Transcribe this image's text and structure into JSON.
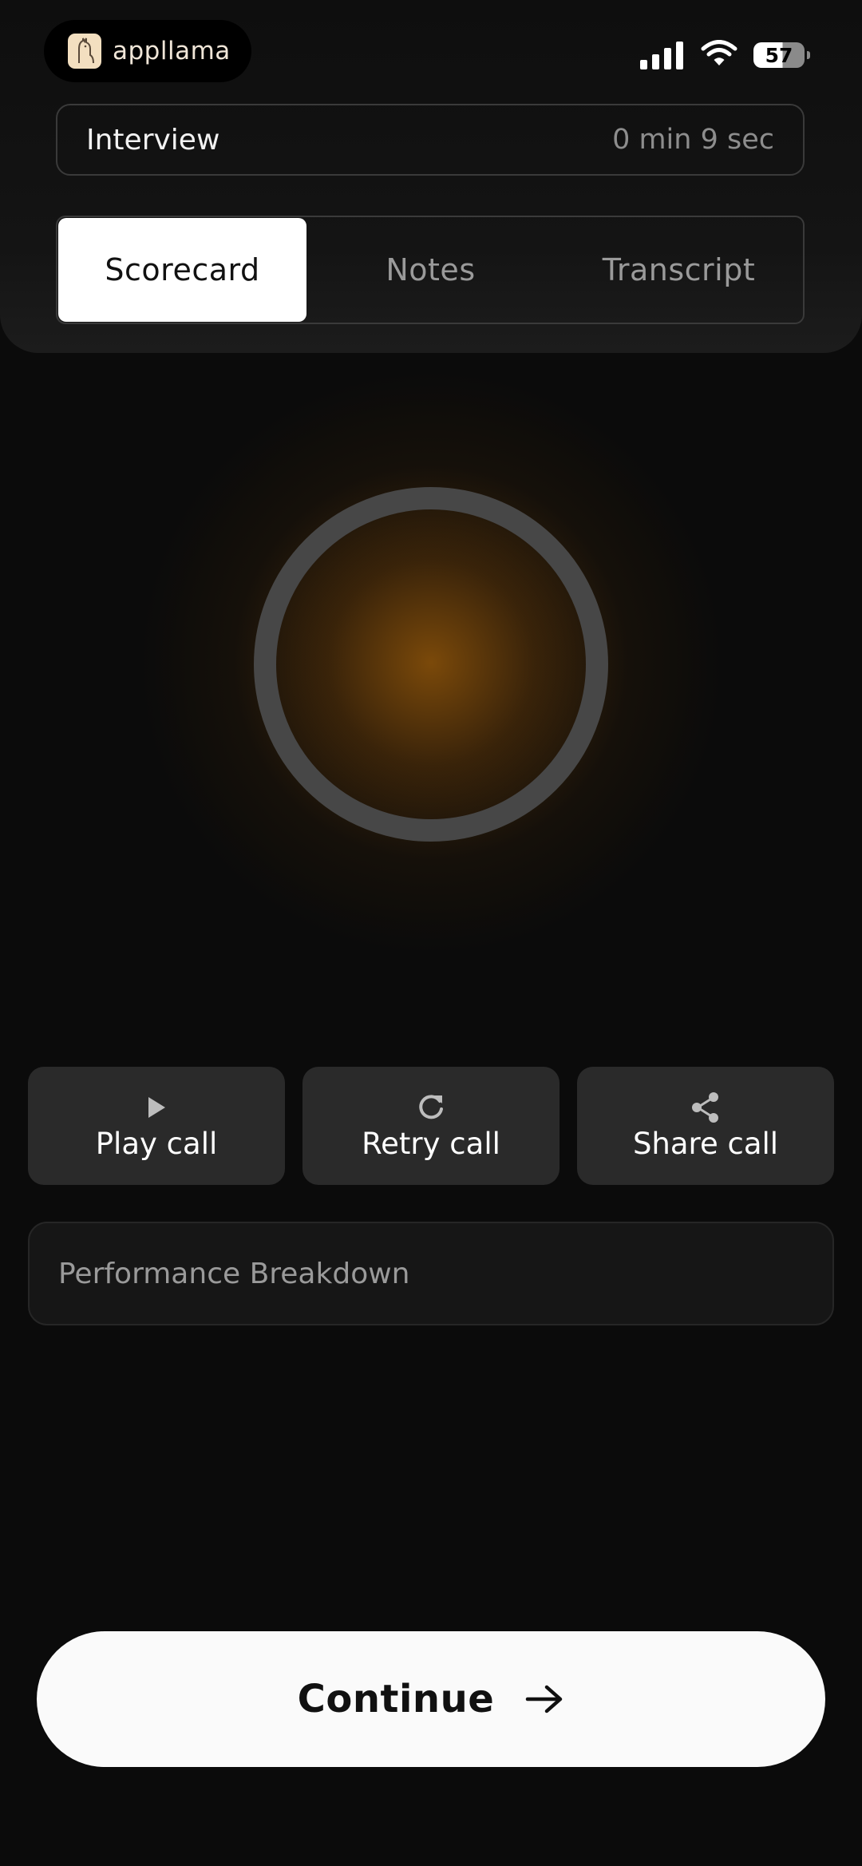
{
  "status_bar": {
    "brand": "appllama",
    "battery": "57"
  },
  "interview": {
    "title": "Interview",
    "timer": "0 min 9 sec"
  },
  "tabs": [
    {
      "label": "Scorecard",
      "active": true
    },
    {
      "label": "Notes",
      "active": false
    },
    {
      "label": "Transcript",
      "active": false
    }
  ],
  "actions": [
    {
      "label": "Play call",
      "icon": "play-icon"
    },
    {
      "label": "Retry call",
      "icon": "refresh-icon"
    },
    {
      "label": "Share call",
      "icon": "share-icon"
    }
  ],
  "performance": {
    "title": "Performance Breakdown"
  },
  "continue": {
    "label": "Continue",
    "icon": "arrow-right-icon"
  },
  "colors": {
    "background": "#0b0b0b",
    "orb_glow": "#87500a",
    "ring": "#474747",
    "button": "#2a2a2a"
  }
}
